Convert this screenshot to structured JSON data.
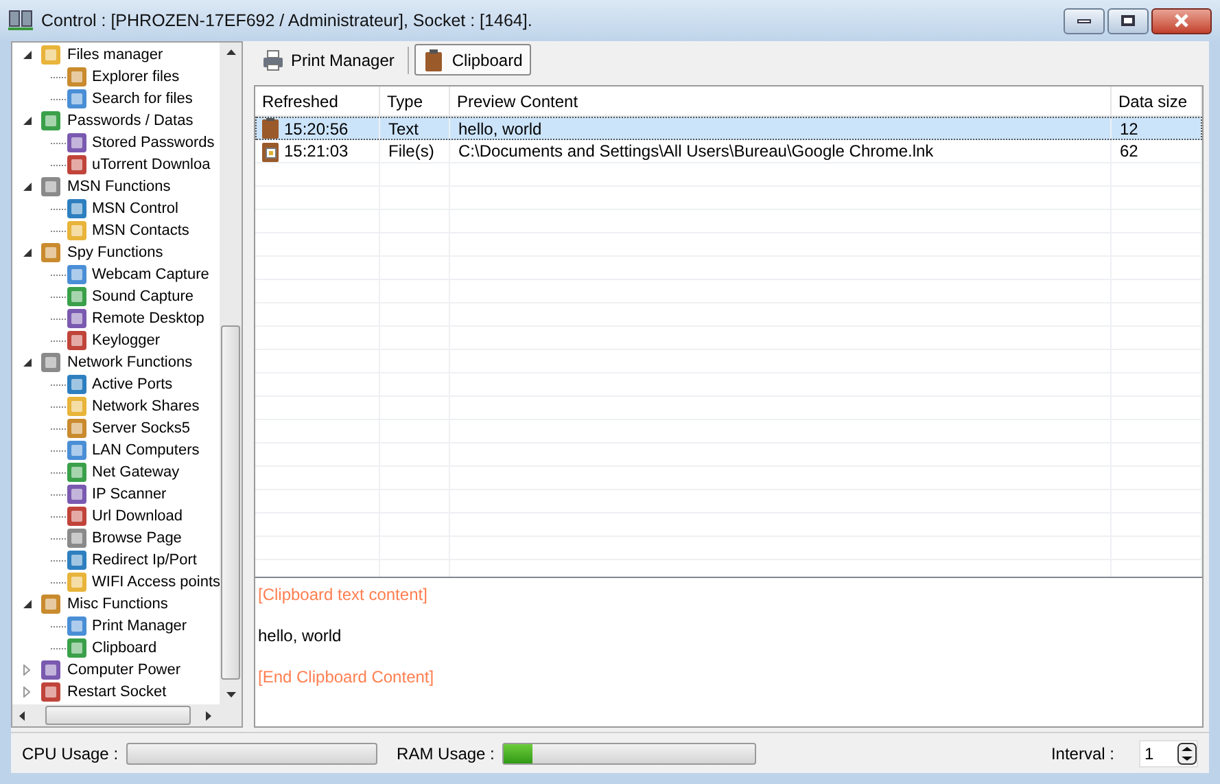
{
  "window": {
    "title": "Control : [PHROZEN-17EF692 / Administrateur], Socket : [1464]."
  },
  "tree": {
    "items": [
      {
        "label": "Files manager",
        "expanded": true,
        "children": [
          {
            "label": "Explorer files"
          },
          {
            "label": "Search for files"
          }
        ]
      },
      {
        "label": "Passwords / Datas",
        "expanded": true,
        "children": [
          {
            "label": "Stored Passwords"
          },
          {
            "label": "uTorrent Downloa"
          }
        ]
      },
      {
        "label": "MSN Functions",
        "expanded": true,
        "children": [
          {
            "label": "MSN Control"
          },
          {
            "label": "MSN Contacts"
          }
        ]
      },
      {
        "label": "Spy Functions",
        "expanded": true,
        "children": [
          {
            "label": "Webcam Capture"
          },
          {
            "label": "Sound Capture"
          },
          {
            "label": "Remote Desktop"
          },
          {
            "label": "Keylogger"
          }
        ]
      },
      {
        "label": "Network Functions",
        "expanded": true,
        "children": [
          {
            "label": "Active Ports"
          },
          {
            "label": "Network Shares"
          },
          {
            "label": "Server Socks5"
          },
          {
            "label": "LAN Computers"
          },
          {
            "label": "Net Gateway"
          },
          {
            "label": "IP Scanner"
          },
          {
            "label": "Url Download"
          },
          {
            "label": "Browse Page"
          },
          {
            "label": "Redirect Ip/Port"
          },
          {
            "label": "WIFI Access points"
          }
        ]
      },
      {
        "label": "Misc Functions",
        "expanded": true,
        "children": [
          {
            "label": "Print Manager"
          },
          {
            "label": "Clipboard"
          }
        ]
      },
      {
        "label": "Computer Power",
        "expanded": false
      },
      {
        "label": "Restart Socket",
        "expanded": false
      }
    ]
  },
  "tabs": [
    {
      "label": "Print Manager",
      "kind": "printer",
      "selected": false
    },
    {
      "label": "Clipboard",
      "kind": "clipboard",
      "selected": true
    }
  ],
  "table": {
    "columns": [
      "Refreshed",
      "Type",
      "Preview Content",
      "Data size"
    ],
    "rows": [
      {
        "kind": "text",
        "selected": true,
        "cells": [
          "15:20:56",
          "Text",
          "hello, world",
          "12"
        ]
      },
      {
        "kind": "file",
        "selected": false,
        "cells": [
          "15:21:03",
          "File(s)",
          "C:\\Documents and Settings\\All Users\\Bureau\\Google Chrome.lnk",
          "62"
        ]
      }
    ]
  },
  "content": {
    "header": "[Clipboard text content]",
    "text": "hello, world",
    "footer": "[End Clipboard Content]"
  },
  "status_bar": {
    "cpu": {
      "label": "CPU Usage :",
      "level": 0
    },
    "ram": {
      "label": "RAM Usage :",
      "level": 0.11
    },
    "interval": {
      "label": "Interval :",
      "value": "1"
    }
  }
}
